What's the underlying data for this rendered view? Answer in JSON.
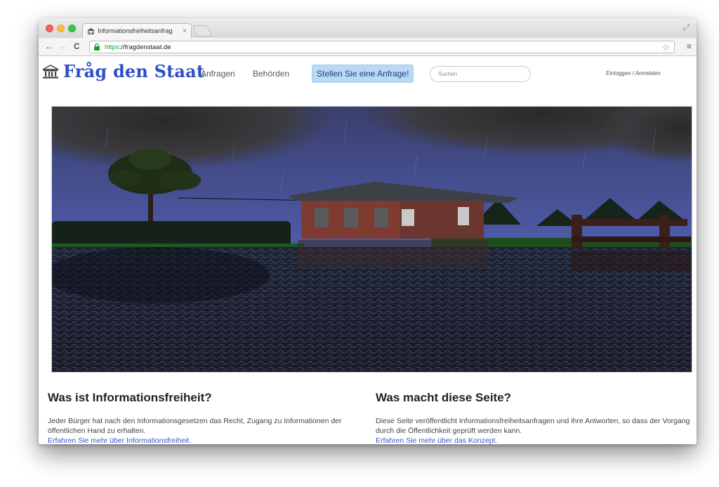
{
  "browser": {
    "tab_title": "Informationsfreiheitsanfrag",
    "tab_close": "×",
    "url_scheme": "https",
    "url_host": "://fragdenstaat.de"
  },
  "site": {
    "logo_text": "Fråg den Staat",
    "nav": {
      "anfragen": "Anfragen",
      "behoerden": "Behörden"
    },
    "cta": "Stellen Sie eine Anfrage!",
    "search_placeholder": "Suchen",
    "login": "Einloggen / Anmelden"
  },
  "sections": {
    "left": {
      "title": "Was ist Informationsfreiheit?",
      "body": "Jeder Bürger hat nach den Informationsgesetzen das Recht, Zugang zu Informationen der öffentlichen Hand zu erhalten.",
      "link": "Erfahren Sie mehr über Informationsfreiheit."
    },
    "right": {
      "title": "Was macht diese Seite?",
      "body": "Diese Seite veröffentlicht Informationsfreiheitsanfragen und ihre Antworten, so dass der Vorgang durch die Öffentlichkeit geprüft werden kann.",
      "link": "Erfahren Sie mehr über das Konzept."
    }
  },
  "colors": {
    "brand_blue": "#2d4fc7",
    "cta_bg": "#b9daf4",
    "link_blue": "#3456c8",
    "secure_green": "#1f9e2e"
  }
}
